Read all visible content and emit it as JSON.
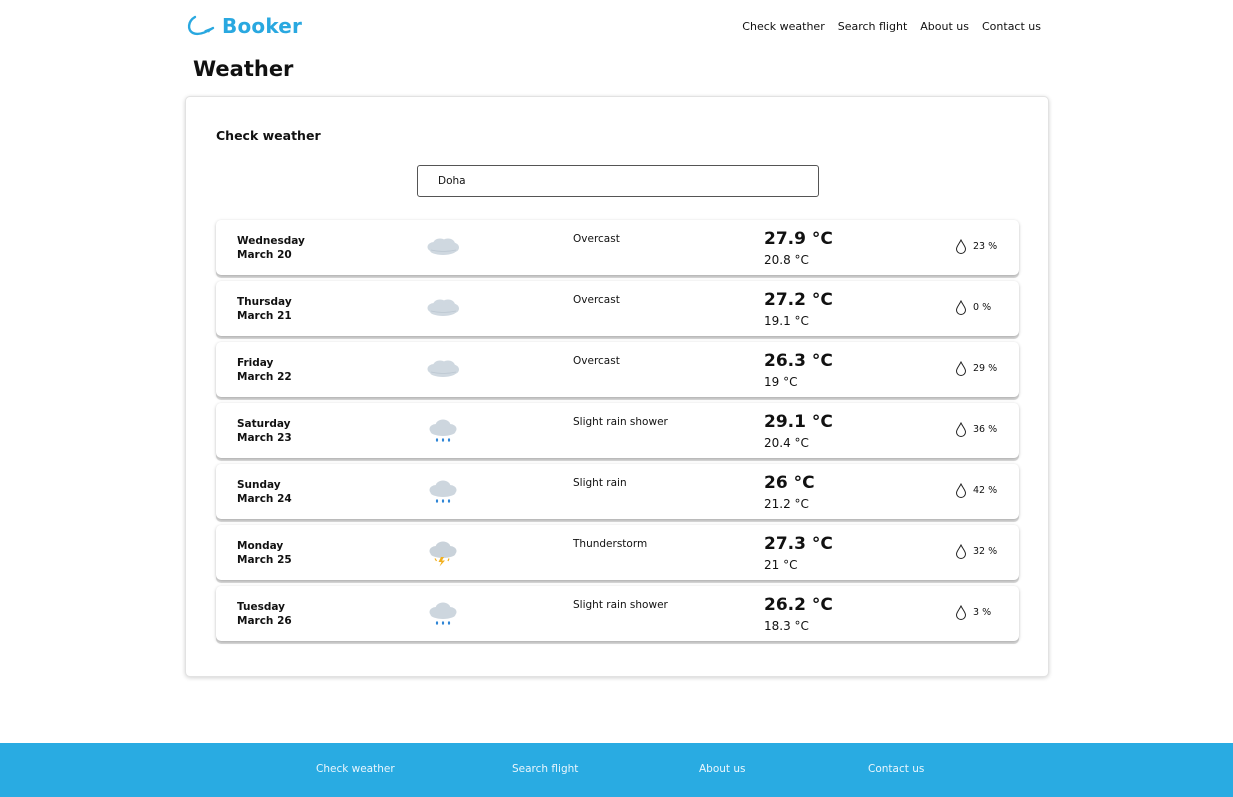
{
  "brand": {
    "name": "Booker",
    "color": "#29a8e0"
  },
  "nav": {
    "check_weather": "Check weather",
    "search_flight": "Search flight",
    "about_us": "About us",
    "contact_us": "Contact us"
  },
  "page": {
    "title": "Weather"
  },
  "weather_card": {
    "title": "Check weather",
    "city_value": "Doha"
  },
  "forecast": [
    {
      "weekday": "Wednesday",
      "date": "March 20",
      "icon": "overcast-cloud-icon",
      "condition": "Overcast",
      "max": "27.9 °C",
      "min": "20.8 °C",
      "precip": "23 %"
    },
    {
      "weekday": "Thursday",
      "date": "March 21",
      "icon": "overcast-cloud-icon",
      "condition": "Overcast",
      "max": "27.2 °C",
      "min": "19.1 °C",
      "precip": "0 %"
    },
    {
      "weekday": "Friday",
      "date": "March 22",
      "icon": "overcast-cloud-icon",
      "condition": "Overcast",
      "max": "26.3 °C",
      "min": "19 °C",
      "precip": "29 %"
    },
    {
      "weekday": "Saturday",
      "date": "March 23",
      "icon": "rain-cloud-icon",
      "condition": "Slight rain shower",
      "max": "29.1 °C",
      "min": "20.4 °C",
      "precip": "36 %"
    },
    {
      "weekday": "Sunday",
      "date": "March 24",
      "icon": "rain-cloud-icon",
      "condition": "Slight rain",
      "max": "26 °C",
      "min": "21.2 °C",
      "precip": "42 %"
    },
    {
      "weekday": "Monday",
      "date": "March 25",
      "icon": "thunderstorm-cloud-icon",
      "condition": "Thunderstorm",
      "max": "27.3 °C",
      "min": "21 °C",
      "precip": "32 %"
    },
    {
      "weekday": "Tuesday",
      "date": "March 26",
      "icon": "rain-cloud-icon",
      "condition": "Slight rain shower",
      "max": "26.2 °C",
      "min": "18.3 °C",
      "precip": "3 %"
    }
  ],
  "footer": {
    "color": "#29abe2",
    "check_weather": "Check weather",
    "search_flight": "Search flight",
    "about_us": "About us",
    "contact_us": "Contact us"
  }
}
